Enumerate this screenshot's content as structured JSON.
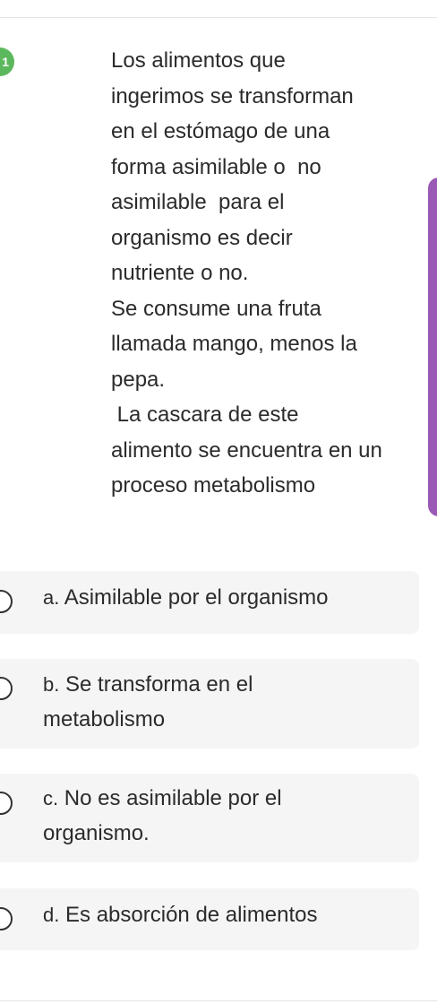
{
  "question": {
    "badge": "1",
    "lines": [
      "Los alimentos que",
      "ingerimos se transforman",
      "en el estómago de una",
      "forma asimilable o  no",
      "asimilable  para el",
      "organismo es decir",
      "nutriente o no.",
      "Se consume una fruta",
      "llamada mango, menos la",
      "pepa.",
      " La cascara de este",
      "alimento se encuentra en un",
      "proceso metabolismo"
    ]
  },
  "options": [
    {
      "letter": "a.",
      "lines": [
        "Asimilable por el organismo"
      ]
    },
    {
      "letter": "b.",
      "lines": [
        "Se transforma en el",
        "metabolismo"
      ]
    },
    {
      "letter": "c.",
      "lines": [
        "No es asimilable por el",
        "organismo."
      ]
    },
    {
      "letter": "d.",
      "lines": [
        "Es absorción de alimentos"
      ]
    }
  ],
  "colors": {
    "badge": "#5cb85c",
    "accent_bar": "#9b59b6",
    "option_background": "#f5f5f5"
  }
}
